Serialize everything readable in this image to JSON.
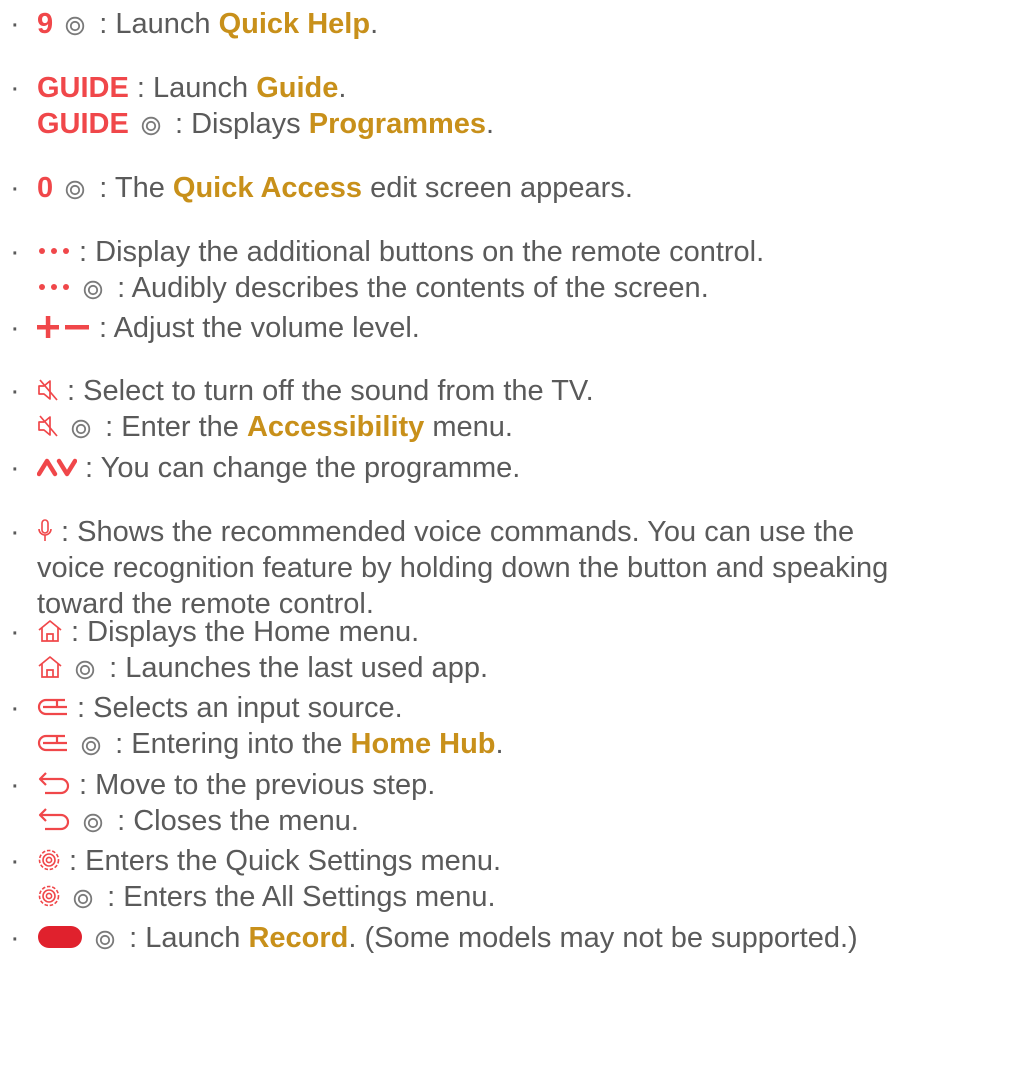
{
  "colors": {
    "accent_red": "#f0474a",
    "link_gold": "#c8901a",
    "text": "#5a5a5a"
  },
  "items": [
    {
      "lines": [
        {
          "key": "9",
          "text1": " : Launch ",
          "link": "Quick Help",
          "text2": "."
        }
      ]
    },
    {
      "lines": [
        {
          "key": "GUIDE",
          "text1": " : Launch ",
          "link": "Guide",
          "text2": "."
        },
        {
          "key": "GUIDE",
          "text1": " : Displays ",
          "link": "Programmes",
          "text2": "."
        }
      ]
    },
    {
      "lines": [
        {
          "key": "0",
          "text1": " : The ",
          "link": "Quick Access",
          "text2": " edit screen appears."
        }
      ]
    },
    {
      "lines": [
        {
          "icon": "more-dots-icon",
          "text1": " : Display the additional buttons on the remote control."
        },
        {
          "icon": "more-dots-icon",
          "text1": " : Audibly describes the contents of the screen."
        }
      ]
    },
    {
      "lines": [
        {
          "icon": "volume-plus-minus-icon",
          "text1": " : Adjust the volume level."
        }
      ]
    },
    {
      "lines": [
        {
          "icon": "mute-icon",
          "text1": " : Select to turn off the sound from the TV."
        },
        {
          "icon": "mute-icon",
          "text1": " : Enter the ",
          "link": "Accessibility",
          "text2": " menu."
        }
      ]
    },
    {
      "lines": [
        {
          "icon": "channel-up-down-icon",
          "text1": " : You can change the programme."
        }
      ]
    },
    {
      "lines": [
        {
          "icon": "microphone-icon",
          "text1": " : Shows the recommended voice commands. You can use the"
        },
        {
          "text1": "voice recognition feature by holding down the button and speaking"
        },
        {
          "text1": "toward the remote control."
        }
      ]
    },
    {
      "lines": [
        {
          "icon": "home-icon",
          "text1": " : Displays the Home menu."
        },
        {
          "icon": "home-icon",
          "text1": " : Launches the last used app."
        }
      ]
    },
    {
      "lines": [
        {
          "icon": "input-source-icon",
          "text1": " : Selects an input source."
        },
        {
          "icon": "input-source-icon",
          "text1": " : Entering into the ",
          "link": "Home Hub",
          "text2": "."
        }
      ]
    },
    {
      "lines": [
        {
          "icon": "back-arrow-icon",
          "text1": " : Move to the previous step."
        },
        {
          "icon": "back-arrow-icon",
          "text1": " : Closes the menu."
        }
      ]
    },
    {
      "lines": [
        {
          "icon": "settings-gear-icon",
          "text1": " : Enters the Quick Settings menu."
        },
        {
          "icon": "settings-gear-icon",
          "text1": " : Enters the All Settings menu."
        }
      ]
    },
    {
      "lines": [
        {
          "icon": "record-button-icon",
          "text1": " : Launch ",
          "link": "Record",
          "text2": ". (Some models may not be supported.)"
        }
      ]
    }
  ]
}
